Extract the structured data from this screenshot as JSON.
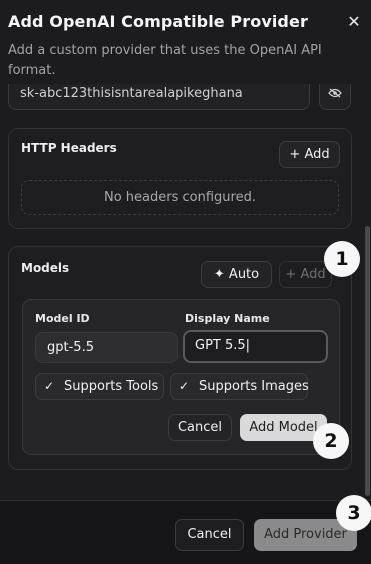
{
  "dialog": {
    "title": "Add OpenAI Compatible Provider",
    "subtitle": "Add a custom provider that uses the OpenAI API format.",
    "close_icon": "close-icon"
  },
  "api_key": {
    "value": "sk-abc123thisisntarealapikeghana",
    "toggle_icon": "eye-icon"
  },
  "headers": {
    "label": "HTTP Headers",
    "add_label": "Add",
    "empty_text": "No headers configured."
  },
  "models": {
    "label": "Models",
    "auto_label": "Auto",
    "add_label": "Add",
    "form": {
      "model_id_label": "Model ID",
      "model_id_value": "gpt-5.5",
      "display_name_label": "Display Name",
      "display_name_value": "GPT 5.5",
      "supports_tools_label": "Supports Tools",
      "supports_tools_checked": true,
      "supports_images_label": "Supports Images",
      "supports_images_checked": true,
      "cancel_label": "Cancel",
      "add_model_label": "Add Model"
    }
  },
  "footer": {
    "cancel_label": "Cancel",
    "add_provider_label": "Add Provider"
  },
  "annotations": [
    "1",
    "2",
    "3"
  ]
}
